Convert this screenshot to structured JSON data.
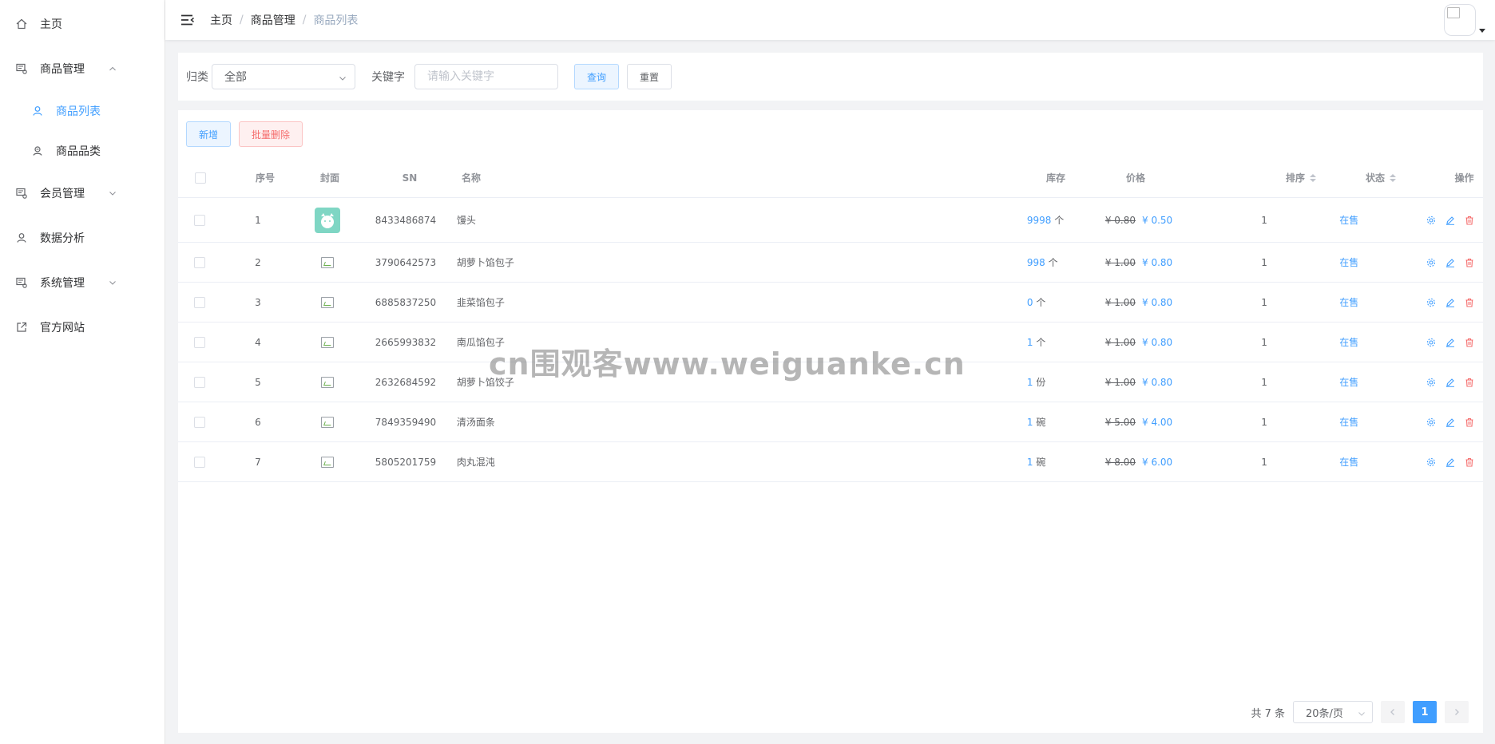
{
  "sidebar": {
    "items": [
      {
        "label": "主页",
        "icon": "home-icon"
      },
      {
        "label": "商品管理",
        "icon": "goods-icon",
        "expanded": true,
        "children": [
          {
            "label": "商品列表",
            "icon": "user-icon",
            "active": true
          },
          {
            "label": "商品品类",
            "icon": "category-icon"
          }
        ]
      },
      {
        "label": "会员管理",
        "icon": "member-icon",
        "expanded": false
      },
      {
        "label": "数据分析",
        "icon": "analysis-icon"
      },
      {
        "label": "系统管理",
        "icon": "system-icon",
        "expanded": false
      },
      {
        "label": "官方网站",
        "icon": "external-link-icon"
      }
    ]
  },
  "header": {
    "breadcrumb": [
      "主页",
      "商品管理",
      "商品列表"
    ],
    "separator": "/"
  },
  "filter": {
    "category_label": "归类",
    "category_value": "全部",
    "keyword_label": "关键字",
    "keyword_placeholder": "请输入关键字",
    "keyword_value": "",
    "search_label": "查询",
    "reset_label": "重置"
  },
  "toolbar": {
    "add_label": "新增",
    "batch_delete_label": "批量删除"
  },
  "table": {
    "columns": {
      "index": "序号",
      "cover": "封面",
      "sn": "SN",
      "name": "名称",
      "stock": "库存",
      "price": "价格",
      "sort": "排序",
      "status": "状态",
      "ops": "操作"
    },
    "rows": [
      {
        "index": "1",
        "sn": "8433486874",
        "name": "馒头",
        "stock": "9998",
        "unit": "个",
        "old_price": "¥ 0.80",
        "price": "¥ 0.50",
        "sort": "1",
        "status": "在售"
      },
      {
        "index": "2",
        "sn": "3790642573",
        "name": "胡萝卜馅包子",
        "stock": "998",
        "unit": "个",
        "old_price": "¥ 1.00",
        "price": "¥ 0.80",
        "sort": "1",
        "status": "在售"
      },
      {
        "index": "3",
        "sn": "6885837250",
        "name": "韭菜馅包子",
        "stock": "0",
        "unit": "个",
        "old_price": "¥ 1.00",
        "price": "¥ 0.80",
        "sort": "1",
        "status": "在售"
      },
      {
        "index": "4",
        "sn": "2665993832",
        "name": "南瓜馅包子",
        "stock": "1",
        "unit": "个",
        "old_price": "¥ 1.00",
        "price": "¥ 0.80",
        "sort": "1",
        "status": "在售"
      },
      {
        "index": "5",
        "sn": "2632684592",
        "name": "胡萝卜馅饺子",
        "stock": "1",
        "unit": "份",
        "old_price": "¥ 1.00",
        "price": "¥ 0.80",
        "sort": "1",
        "status": "在售"
      },
      {
        "index": "6",
        "sn": "7849359490",
        "name": "清汤面条",
        "stock": "1",
        "unit": "碗",
        "old_price": "¥ 5.00",
        "price": "¥ 4.00",
        "sort": "1",
        "status": "在售"
      },
      {
        "index": "7",
        "sn": "5805201759",
        "name": "肉丸混沌",
        "stock": "1",
        "unit": "碗",
        "old_price": "¥ 8.00",
        "price": "¥ 6.00",
        "sort": "1",
        "status": "在售"
      }
    ]
  },
  "pagination": {
    "total_text": "共 7 条",
    "page_size": "20条/页",
    "current_page": "1"
  },
  "watermark": "cn围观客www.weiguanke.cn",
  "colors": {
    "primary": "#409eff",
    "danger": "#f56c6c",
    "thumb": "#7fd6c4"
  }
}
